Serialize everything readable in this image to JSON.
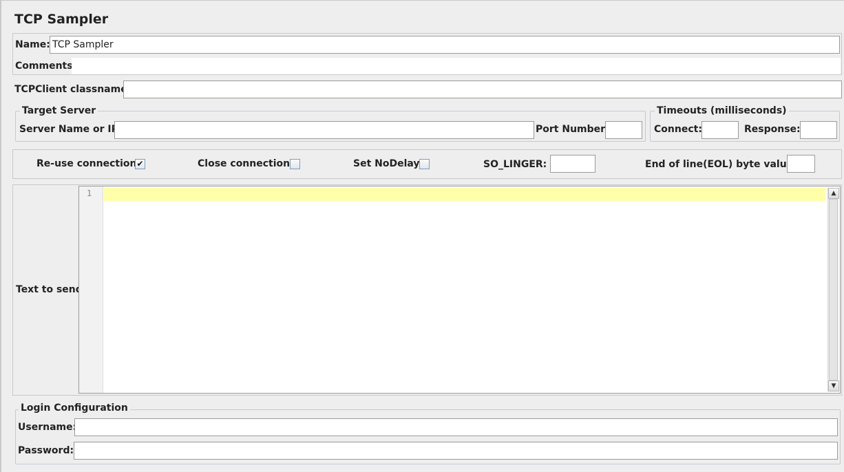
{
  "title": "TCP Sampler",
  "name": {
    "label": "Name:",
    "value": "TCP Sampler"
  },
  "comments": {
    "label": "Comments:",
    "value": ""
  },
  "classname": {
    "label": "TCPClient classname:",
    "value": ""
  },
  "target_server": {
    "legend": "Target Server",
    "server_label": "Server Name or IP:",
    "server_value": "",
    "port_label": "Port Number:",
    "port_value": ""
  },
  "timeouts": {
    "legend": "Timeouts (milliseconds)",
    "connect_label": "Connect:",
    "connect_value": "",
    "response_label": "Response:",
    "response_value": ""
  },
  "options": {
    "reuse_label": "Re-use connection",
    "reuse_checked": true,
    "close_label": "Close connection",
    "close_checked": false,
    "nodelay_label": "Set NoDelay",
    "nodelay_checked": false,
    "linger_label": "SO_LINGER:",
    "linger_value": "",
    "eol_label": "End of line(EOL) byte value:",
    "eol_value": ""
  },
  "text_to_send": {
    "label": "Text to send",
    "line_number": "1",
    "content": "",
    "highlight_color": "#ffffaa"
  },
  "login": {
    "legend": "Login Configuration",
    "username_label": "Username:",
    "username_value": "",
    "password_label": "Password:",
    "password_value": ""
  },
  "icons": {
    "scroll_up": "scroll-up-arrow-icon",
    "scroll_down": "scroll-down-arrow-icon",
    "check": "checkmark-icon"
  }
}
